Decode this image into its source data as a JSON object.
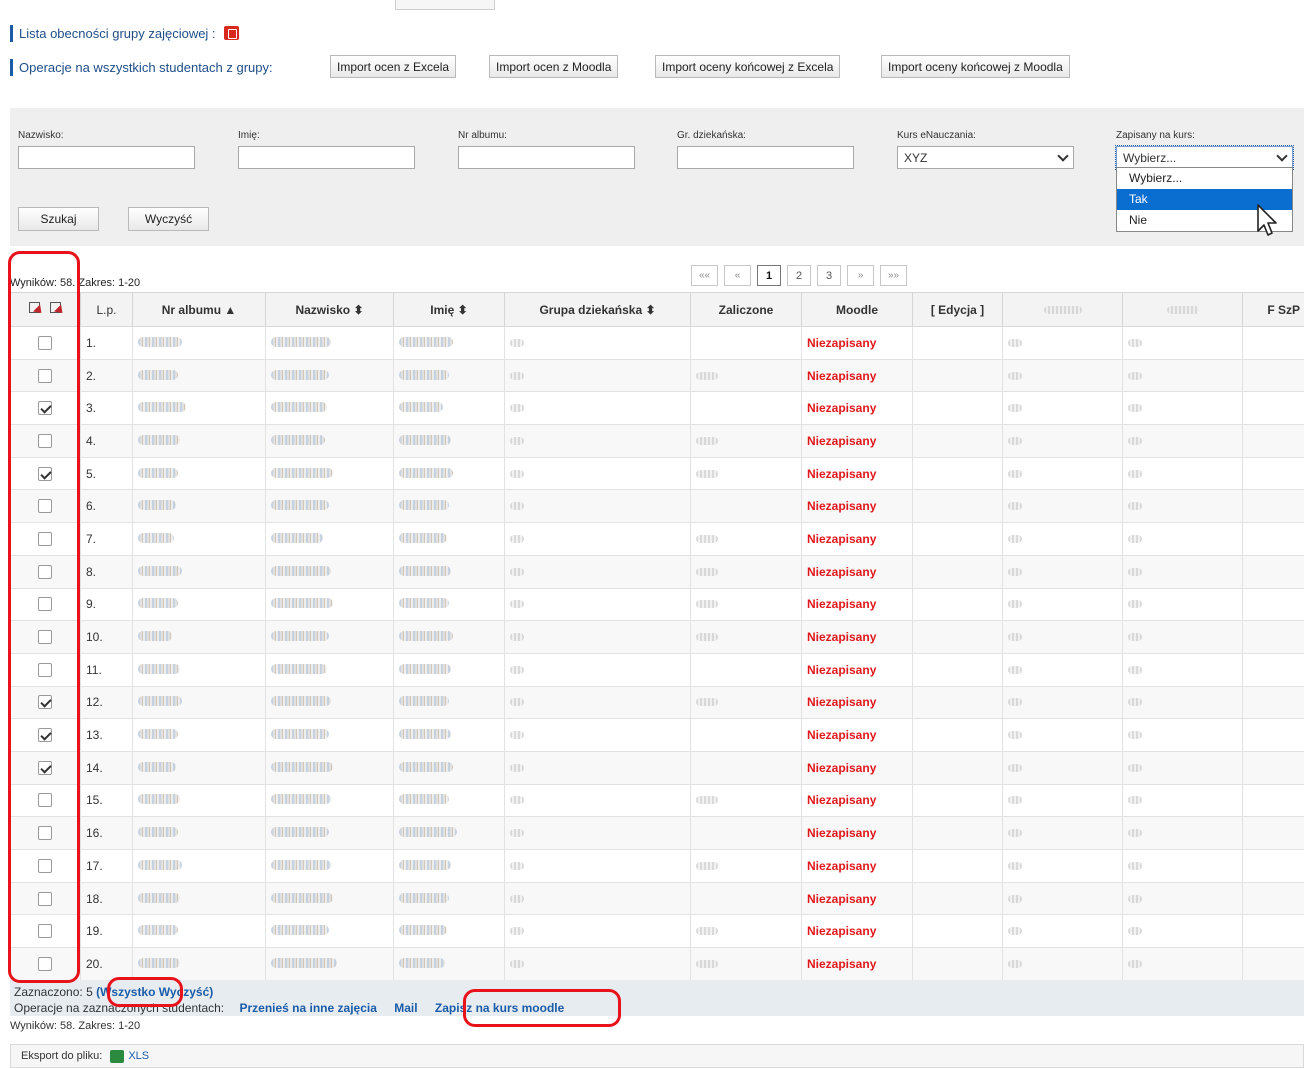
{
  "header": {
    "attendance_label": "Lista obecności grupy zajęciowej :",
    "ops_all_label": "Operacje na wszystkich studentach z grupy:",
    "import_buttons": [
      "Import ocen z Excela",
      "Import ocen z Moodla",
      "Import oceny końcowej z Excela",
      "Import oceny końcowej z Moodla"
    ]
  },
  "filters": {
    "surname_label": "Nazwisko:",
    "first_name_label": "Imię:",
    "album_label": "Nr albumu:",
    "dean_group_label": "Gr. dziekańska:",
    "course_label": "Kurs eNauczania:",
    "course_value": "XYZ",
    "enrolled_label": "Zapisany na kurs:",
    "enrolled_value": "Wybierz...",
    "enrolled_options": [
      "Wybierz...",
      "Tak",
      "Nie"
    ],
    "search_button": "Szukaj",
    "clear_button": "Wyczyść"
  },
  "results": {
    "top_label": "Wyników: 58. Zakres: 1-20",
    "bottom_label": "Wyników: 58. Zakres: 1-20",
    "pager": {
      "first": "««",
      "prev": "«",
      "pages": [
        "1",
        "2",
        "3"
      ],
      "next": "»",
      "last": "»»"
    }
  },
  "table": {
    "headers": {
      "lp": "L.p.",
      "album": "Nr albumu ▲",
      "surname": "Nazwisko ⬍",
      "name": "Imię ⬍",
      "group": "Grupa dziekańska ⬍",
      "passed": "Zaliczone",
      "moodle": "Moodle",
      "edit": "[ Edycja ]",
      "fszp": "F SzP"
    },
    "status_text": "Niezapisany",
    "rows": [
      {
        "lp": "1.",
        "checked": false,
        "passed": false
      },
      {
        "lp": "2.",
        "checked": false,
        "passed": true
      },
      {
        "lp": "3.",
        "checked": true,
        "passed": false
      },
      {
        "lp": "4.",
        "checked": false,
        "passed": true
      },
      {
        "lp": "5.",
        "checked": true,
        "passed": true
      },
      {
        "lp": "6.",
        "checked": false,
        "passed": false
      },
      {
        "lp": "7.",
        "checked": false,
        "passed": true
      },
      {
        "lp": "8.",
        "checked": false,
        "passed": true
      },
      {
        "lp": "9.",
        "checked": false,
        "passed": true
      },
      {
        "lp": "10.",
        "checked": false,
        "passed": true
      },
      {
        "lp": "11.",
        "checked": false,
        "passed": false
      },
      {
        "lp": "12.",
        "checked": true,
        "passed": true
      },
      {
        "lp": "13.",
        "checked": true,
        "passed": false
      },
      {
        "lp": "14.",
        "checked": true,
        "passed": false
      },
      {
        "lp": "15.",
        "checked": false,
        "passed": true
      },
      {
        "lp": "16.",
        "checked": false,
        "passed": false
      },
      {
        "lp": "17.",
        "checked": false,
        "passed": true
      },
      {
        "lp": "18.",
        "checked": false,
        "passed": false
      },
      {
        "lp": "19.",
        "checked": false,
        "passed": true
      },
      {
        "lp": "20.",
        "checked": false,
        "passed": true
      }
    ]
  },
  "footer": {
    "selected_label": "Zaznaczono:",
    "selected_count": "5",
    "all_link": "(Wszystko",
    "clear_link": "Wyczyść)",
    "ops_selected_label": "Operacje na zaznaczonych studentach:",
    "move_link": "Przenieś na inne zajęcia",
    "mail_link": "Mail",
    "enroll_link": "Zapisz na kurs moodle"
  },
  "export": {
    "label": "Eksport do pliku:",
    "xls": "XLS"
  },
  "colors": {
    "accent": "#1a5ca8",
    "status": "#e0181b",
    "highlight": "#e8121a"
  }
}
